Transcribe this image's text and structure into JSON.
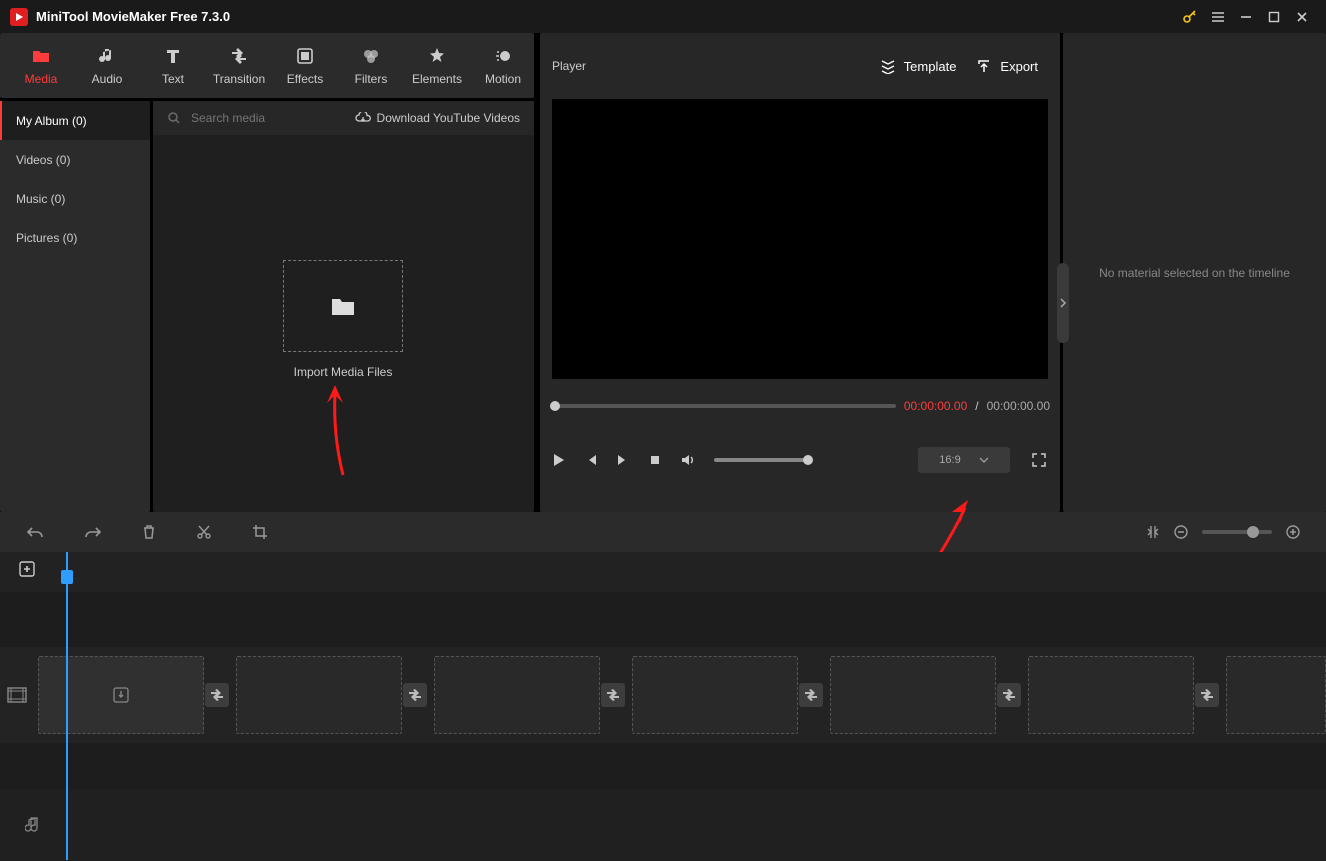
{
  "app": {
    "title": "MiniTool MovieMaker Free 7.3.0"
  },
  "toolbar": {
    "media": "Media",
    "audio": "Audio",
    "text": "Text",
    "transition": "Transition",
    "effects": "Effects",
    "filters": "Filters",
    "elements": "Elements",
    "motion": "Motion"
  },
  "sidebar": {
    "my_album": "My Album (0)",
    "videos": "Videos (0)",
    "music": "Music (0)",
    "pictures": "Pictures (0)"
  },
  "media": {
    "search_placeholder": "Search media",
    "download_yt": "Download YouTube Videos",
    "import_label": "Import Media Files"
  },
  "player": {
    "label": "Player",
    "template": "Template",
    "export": "Export",
    "tc_current": "00:00:00.00",
    "tc_total": "00:00:00.00",
    "aspect": "16:9"
  },
  "props": {
    "empty": "No material selected on the timeline"
  }
}
